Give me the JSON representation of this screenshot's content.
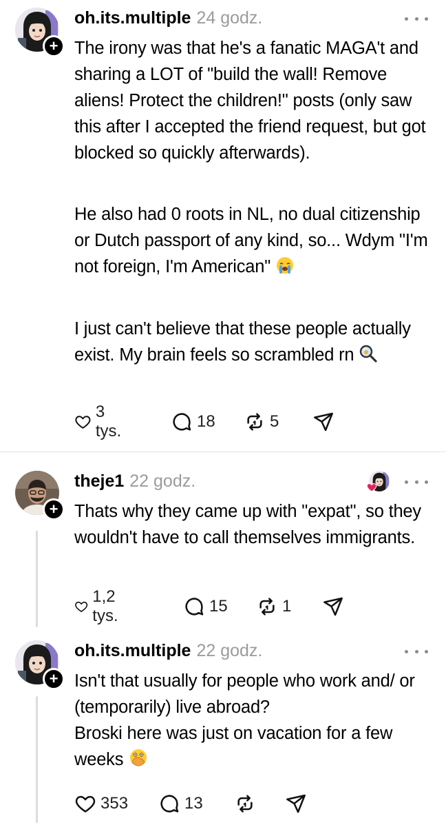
{
  "posts": [
    {
      "username": "oh.its.multiple",
      "time": "24 godz.",
      "paragraphs": [
        "The irony was that he's a fanatic MAGA't and sharing a LOT of \"build the wall! Remove aliens! Protect the children!\" posts (only saw this after I accepted the friend request, but got blocked so quickly afterwards).",
        "He also had 0 roots in NL, no dual citizenship or Dutch passport of any kind, so... Wdym \"I'm not foreign, I'm American\"",
        "I just can't believe that these people actually exist. My brain feels so scrambled rn"
      ],
      "likes": "3 tys.",
      "replies": "18",
      "reposts": "5"
    },
    {
      "username": "theje1",
      "time": "22 godz.",
      "paragraphs": [
        "Thats why they came up with \"expat\", so they wouldn't have to call themselves immigrants."
      ],
      "likes": "1,2 tys.",
      "replies": "15",
      "reposts": "1"
    },
    {
      "username": "oh.its.multiple",
      "time": "22 godz.",
      "paragraphs": [
        "Isn't that usually for people who work and/ or (temporarily) live abroad?",
        "Broski here was just on vacation for a few weeks"
      ],
      "likes": "353",
      "replies": "13",
      "reposts": ""
    }
  ],
  "icons": {
    "like": "heart-icon",
    "reply": "comment-bubble-icon",
    "repost": "repost-arrows-icon",
    "share": "send-paper-plane-icon",
    "more": "more-dots-icon",
    "follow": "plus-badge-icon"
  },
  "colors": {
    "timestamp": "#9b9b9b",
    "liked_heart": "#e0245e",
    "divider": "#e3e3e3"
  }
}
